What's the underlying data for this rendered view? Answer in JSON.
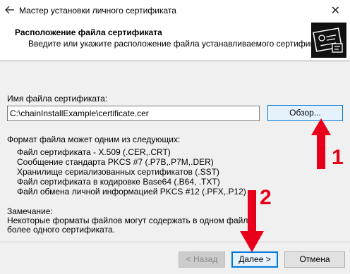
{
  "window": {
    "title": "Мастер установки личного сертификата",
    "close_glyph": "✕"
  },
  "header": {
    "title": "Расположение файла сертификата",
    "subtitle": "Введите или укажите расположение файла устанавливаемого сертификата"
  },
  "main": {
    "file_label": "Имя файла сертификата:",
    "file_value": "C:\\chainInstallExample\\certificate.cer",
    "browse_label": "Обзор...",
    "formats_label": "Формат файла может одним из следующих:",
    "formats": [
      "Файл сертификата - X.509 (.CER,.CRT)",
      "Сообщение стандарта PKCS #7 (.P7B,.P7M,.DER)",
      "Хранилище сериализованных сертификатов (.SST)",
      "Файл сертификата в кодировке Base64 (.B64, .TXT)",
      "Файл обмена личной информацией PKCS #12 (.PFX,.P12)"
    ],
    "note_title": "Замечание:",
    "note_lines": [
      "Некоторые форматы файлов могут содержать в одном файле",
      "более одного сертификата."
    ]
  },
  "footer": {
    "back_label": "< Назад",
    "next_label": "Далее >",
    "cancel_label": "Отмена"
  },
  "annotations": {
    "step1": "1",
    "step2": "2",
    "color": "#e8001a"
  },
  "colors": {
    "accent": "#0078d7",
    "header_bg": "#ffffff",
    "body_bg": "#f0f0f0"
  }
}
